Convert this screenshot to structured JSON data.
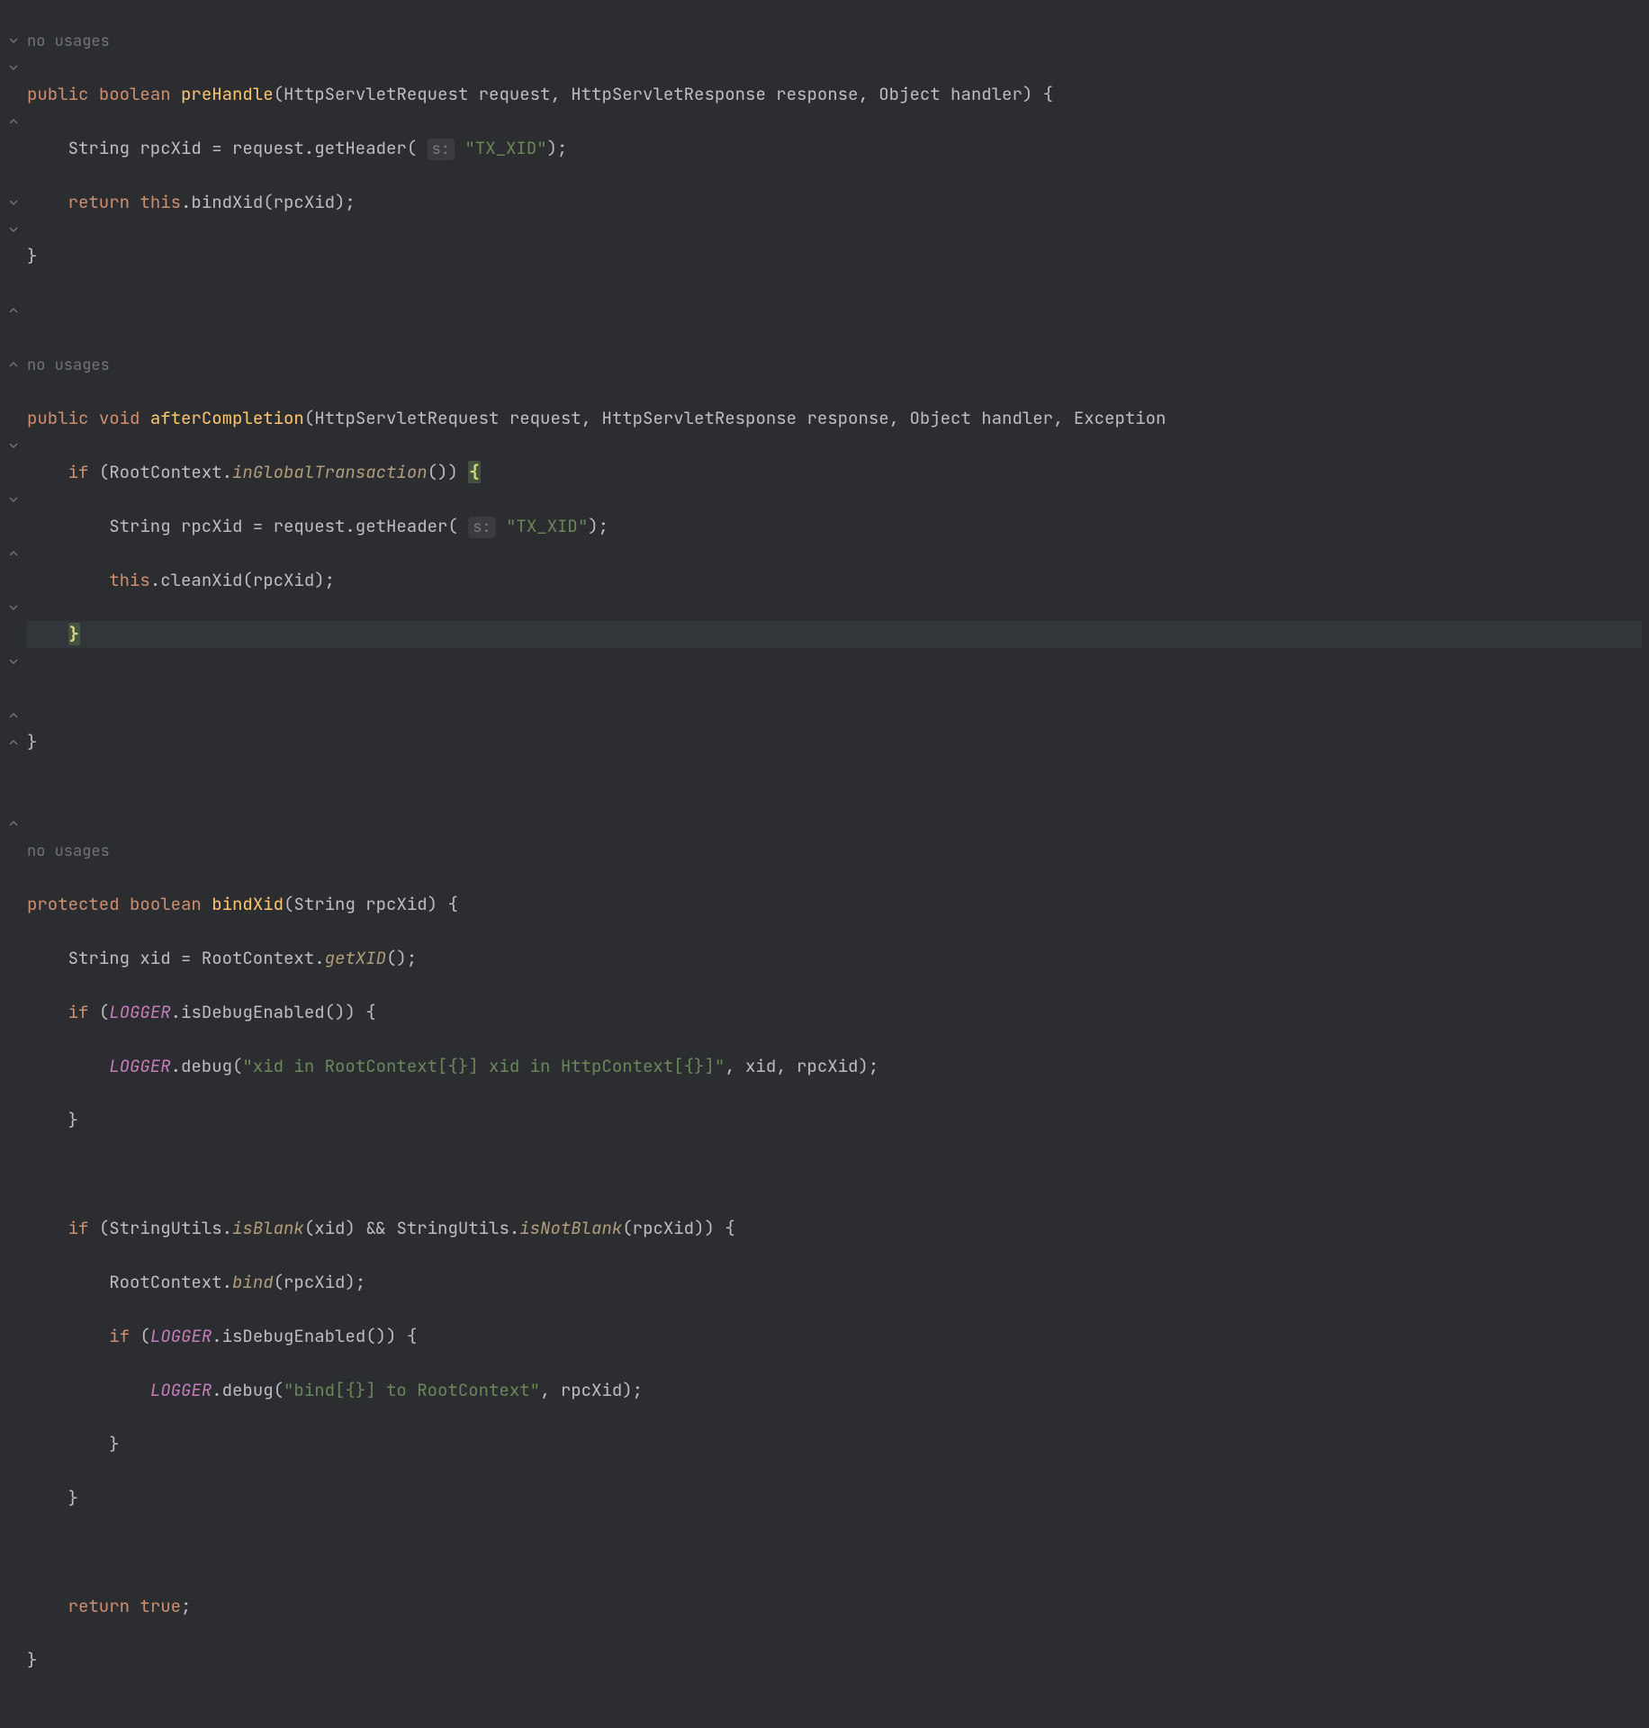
{
  "anno": {
    "no_usages": "no usages"
  },
  "kw": {
    "public": "public",
    "boolean": "boolean",
    "void": "void",
    "protected": "protected",
    "return": "return",
    "this": "this",
    "if": "if",
    "true": "true"
  },
  "fn": {
    "preHandle": "preHandle",
    "afterCompletion": "afterCompletion",
    "bindXid": "bindXid"
  },
  "fni": {
    "inGlobalTransaction": "inGlobalTransaction",
    "getXID": "getXID",
    "isBlank": "isBlank",
    "isNotBlank": "isNotBlank",
    "bind": "bind"
  },
  "const": {
    "LOGGER": "LOGGER"
  },
  "hint": {
    "s": "s:"
  },
  "str": {
    "tx_xid": "\"TX_XID\"",
    "debug1": "\"xid in RootContext[{}] xid in HttpContext[{}]\"",
    "debug2": "\"bind[{}] to RootContext\""
  },
  "sig": {
    "preHandle": "(HttpServletRequest request, HttpServletResponse response, Object handler) {",
    "afterCompletion": "(HttpServletRequest request, HttpServletResponse response, Object handler, Exception",
    "bindXid": "(String rpcXid) {"
  },
  "line": {
    "l2a": "    String rpcXid = request.getHeader( ",
    "l2b": " ",
    "l2c": ");",
    "l3a": "    ",
    "l3b": " ",
    "l3c": ".bindXid(rpcXid);",
    "l4": "}",
    "l8a": "    ",
    "l8b": " (RootContext.",
    "l8c": "()) ",
    "l9a": "        String rpcXid = request.getHeader( ",
    "l10a": "        ",
    "l10b": ".cleanXid(rpcXid);",
    "l11a": "    ",
    "l13": "}",
    "l16a": "    String xid = RootContext.",
    "l16b": "();",
    "l17a": "    ",
    "l17b": " (",
    "l17c": ".isDebugEnabled()) {",
    "l18a": "        ",
    "l18b": ".debug(",
    "l18c": ", xid, rpcXid);",
    "l19": "    }",
    "l21a": "    ",
    "l21b": " (StringUtils.",
    "l21c": "(xid) && StringUtils.",
    "l21d": "(rpcXid)) {",
    "l22a": "        RootContext.",
    "l22b": "(rpcXid);",
    "l23a": "        ",
    "l23b": " (",
    "l23c": ".isDebugEnabled()) {",
    "l24a": "            ",
    "l24b": ".debug(",
    "l24c": ", rpcXid);",
    "l25": "        }",
    "l26": "    }",
    "l28a": "    ",
    "l28b": " ",
    "l28c": ";",
    "l29": "}"
  }
}
